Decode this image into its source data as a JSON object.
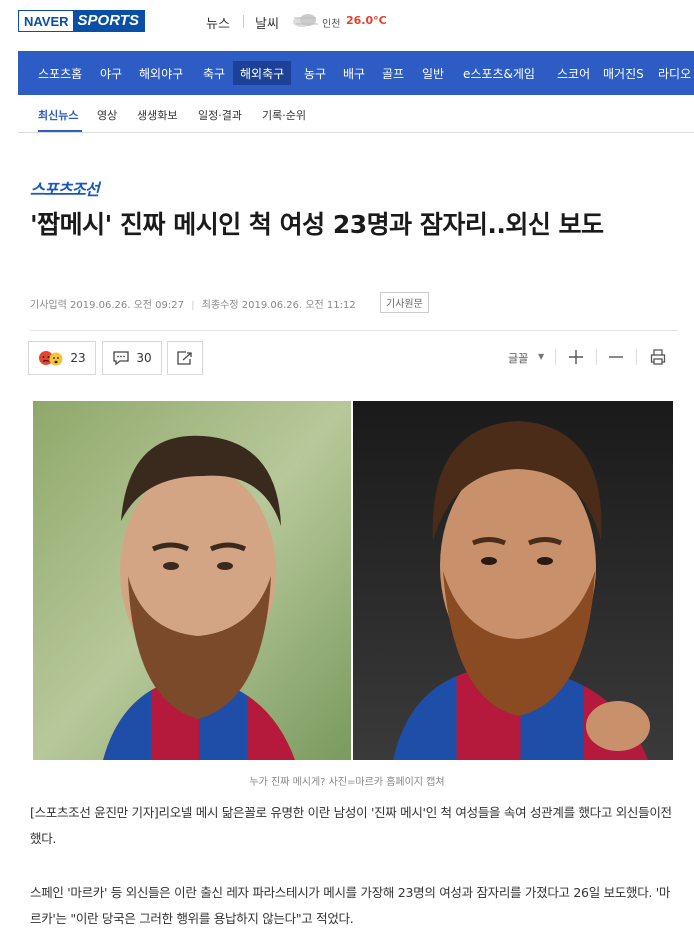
{
  "logo": {
    "naver": "NAVER",
    "sports": "SPORTS"
  },
  "top_links": {
    "news": "뉴스",
    "weather": "날씨"
  },
  "weather": {
    "city": "인천",
    "temp": "26.0°C",
    "icon": "cloud-icon"
  },
  "gnb": [
    "스포츠홈",
    "야구",
    "해외야구",
    "축구",
    "해외축구",
    "농구",
    "배구",
    "골프",
    "일반",
    "e스포츠&게임",
    "스코어",
    "매거진S",
    "라디오"
  ],
  "lnb": [
    "최신뉴스",
    "영상",
    "생생화보",
    "일정·결과",
    "기록·순위"
  ],
  "article": {
    "press": "스포츠조선",
    "headline": "'짭메시' 진짜 메시인 척 여성 23명과 잠자리..외신 보도",
    "input_date": "기사입력 2019.06.26. 오전 09:27",
    "modified_date": "최종수정 2019.06.26. 오전 11:12",
    "original_btn": "기사원문",
    "reactions": "23",
    "comments": "30",
    "font_label": "글꼴",
    "caption": "누가 진짜 메시게? 사진=마르카 홈페이지 캡쳐",
    "para1": "[스포츠조선 윤진만 기자]리오넬 메시 닮은꼴로 유명한 이란 남성이 '진짜 메시'인 척 여성들을 속여 성관계를 했다고 외신들이전했다.",
    "para2": "스페인 '마르카' 등 외신들은 이란 출신 레자 파라스테시가 메시를 가장해 23명의 여성과 잠자리를 가졌다고 26일 보도했다. '마르카'는 \"이란 당국은 그러한 행위를 용납하지 않는다\"고 적었다."
  },
  "colors": {
    "brand": "#2c5cc4",
    "logo": "#0a4fa6",
    "temp": "#e2412b",
    "press": "#1a56c0"
  }
}
